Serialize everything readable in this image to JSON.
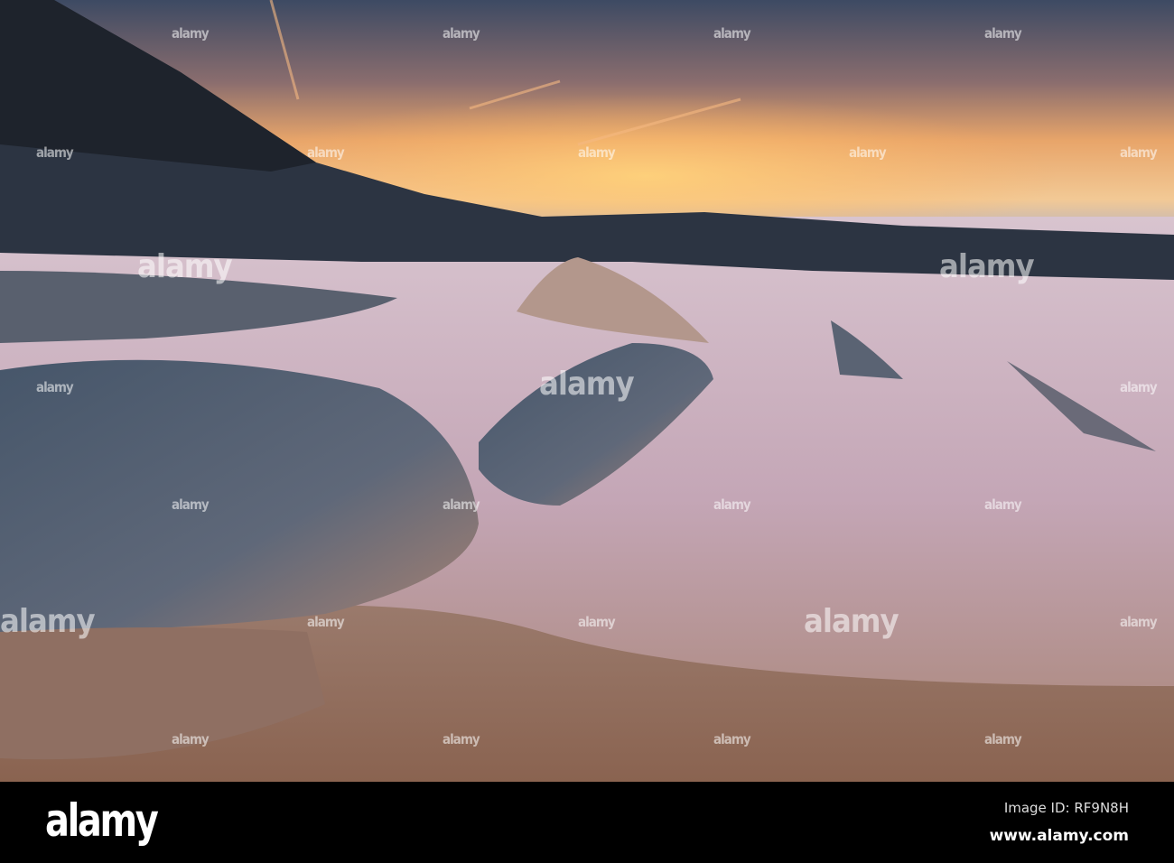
{
  "watermark": "alamy",
  "footer": {
    "logo": "alamy",
    "image_id": "Image ID: RF9N8H",
    "website": "www.alamy.com"
  }
}
